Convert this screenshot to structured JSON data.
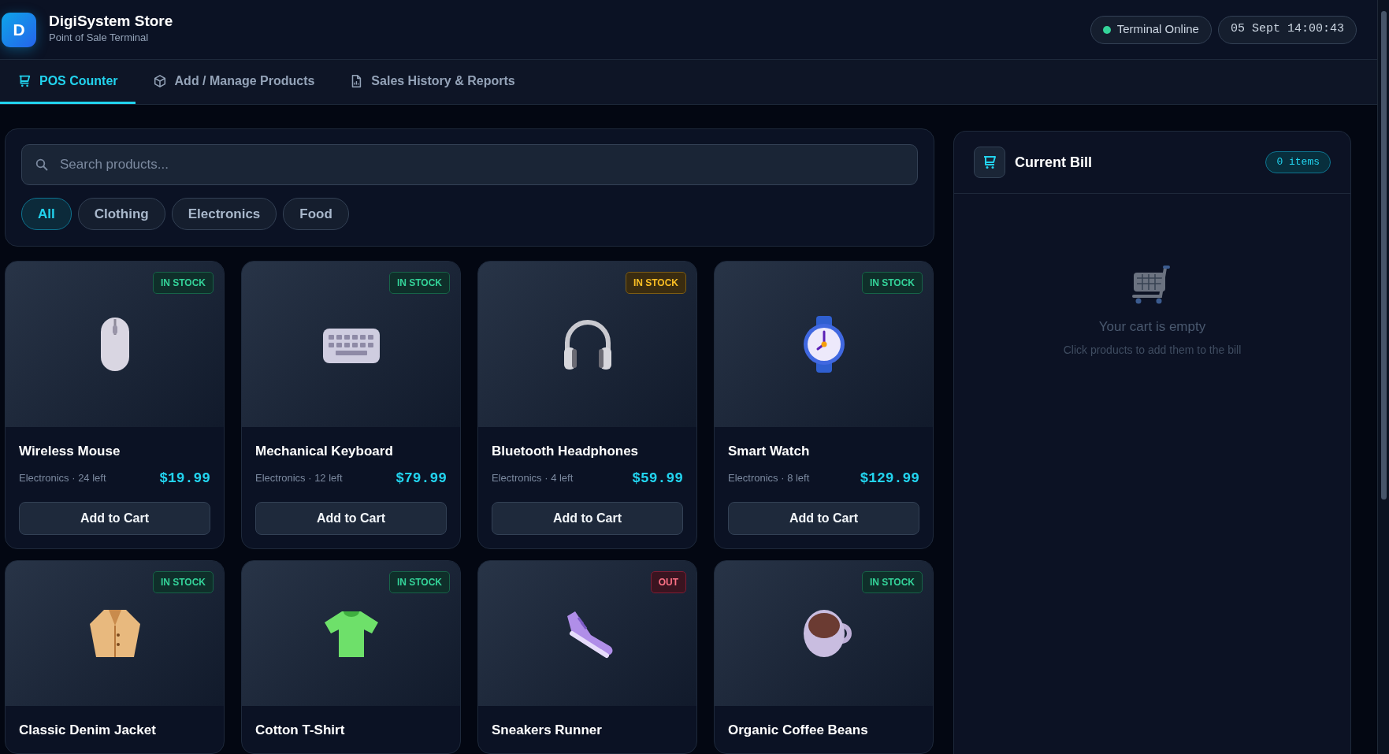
{
  "header": {
    "logo_letter": "D",
    "title": "DigiSystem Store",
    "subtitle": "Point of Sale Terminal",
    "status": {
      "label": "Terminal Online",
      "color": "#34d399"
    },
    "datetime": "05 Sept 14:00:43"
  },
  "tabs": [
    {
      "label": "POS Counter",
      "selected": true
    },
    {
      "label": "Add / Manage Products",
      "selected": false
    },
    {
      "label": "Sales History & Reports",
      "selected": false
    }
  ],
  "search": {
    "placeholder": "Search products..."
  },
  "filters": [
    {
      "label": "All",
      "selected": true
    },
    {
      "label": "Clothing",
      "selected": false
    },
    {
      "label": "Electronics",
      "selected": false
    },
    {
      "label": "Food",
      "selected": false
    }
  ],
  "products": [
    {
      "name": "Wireless Mouse",
      "meta": "Electronics · 24 left",
      "price": "$19.99",
      "badge": "IN STOCK",
      "kind": "in",
      "button": "Add to Cart"
    },
    {
      "name": "Mechanical Keyboard",
      "meta": "Electronics · 12 left",
      "price": "$79.99",
      "badge": "IN STOCK",
      "kind": "in",
      "button": "Add to Cart"
    },
    {
      "name": "Bluetooth Headphones",
      "meta": "Electronics · 4 left",
      "price": "$59.99",
      "badge": "IN STOCK",
      "kind": "low",
      "button": "Add to Cart"
    },
    {
      "name": "Smart Watch",
      "meta": "Electronics · 8 left",
      "price": "$129.99",
      "badge": "IN STOCK",
      "kind": "in",
      "button": "Add to Cart"
    },
    {
      "name": "Classic Denim Jacket",
      "badge": "IN STOCK",
      "kind": "in"
    },
    {
      "name": "Cotton T-Shirt",
      "badge": "IN STOCK",
      "kind": "in"
    },
    {
      "name": "Sneakers Runner",
      "badge": "OUT",
      "kind": "out"
    },
    {
      "name": "Organic Coffee Beans",
      "badge": "IN STOCK",
      "kind": "in"
    }
  ],
  "bill": {
    "title": "Current Bill",
    "count": "0 items",
    "empty_title": "Your cart is empty",
    "empty_hint": "Click products to add them to the bill"
  }
}
